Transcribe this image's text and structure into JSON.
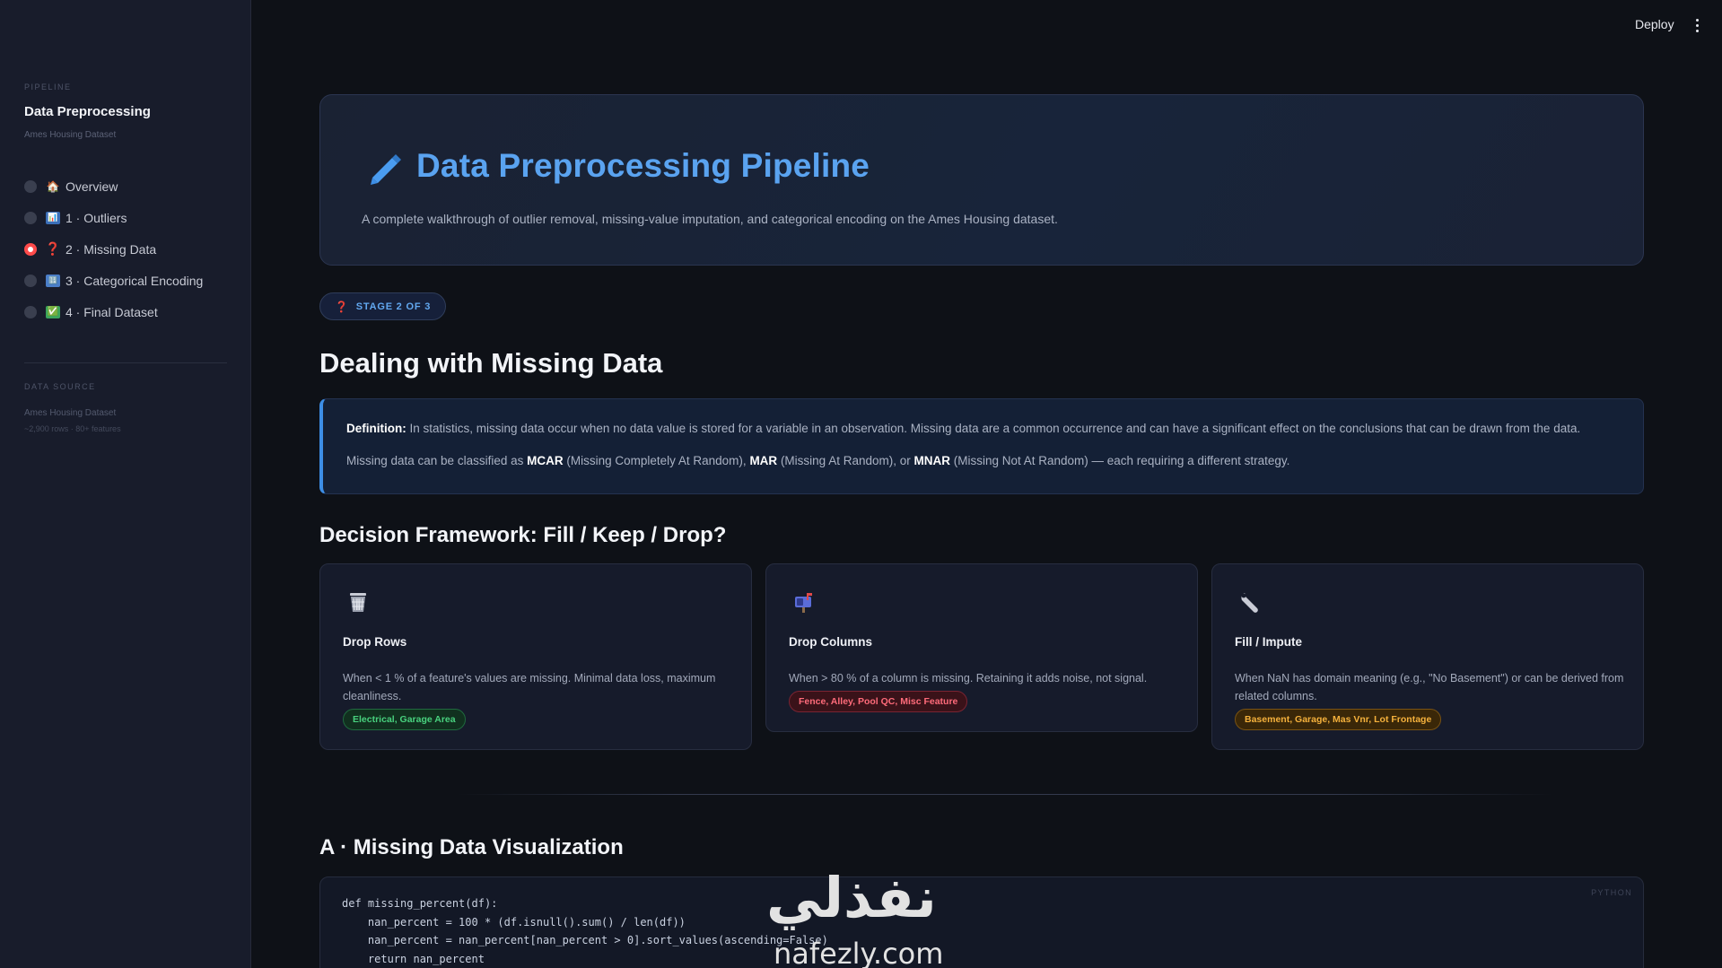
{
  "sidebar": {
    "kicker": "PIPELINE",
    "title": "Data Preprocessing",
    "subtitle": "Ames Housing Dataset",
    "items": [
      {
        "emoji": "🏠",
        "label": "Overview",
        "active": false
      },
      {
        "emoji": "📊",
        "label": "1 · Outliers",
        "active": false
      },
      {
        "emoji": "❓",
        "label": "2 · Missing Data",
        "active": true
      },
      {
        "emoji": "🔢",
        "label": "3 · Categorical Encoding",
        "active": false
      },
      {
        "emoji": "✅",
        "label": "4 · Final Dataset",
        "active": false
      }
    ],
    "data_source_kicker": "DATA SOURCE",
    "data_source_name": "Ames Housing Dataset",
    "data_source_meta": "~2,900 rows · 80+ features"
  },
  "header": {
    "deploy_label": "Deploy"
  },
  "hero": {
    "icon": "pencil-icon",
    "title": "Data Preprocessing Pipeline",
    "description": "A complete walkthrough of outlier removal, missing-value imputation, and categorical encoding on the Ames Housing dataset."
  },
  "stage_badge": {
    "icon": "❓",
    "label": "STAGE 2 OF 3"
  },
  "section_missing": {
    "title": "Dealing with Missing Data",
    "definition": {
      "label": "Definition:",
      "text": " In statistics, missing data occur when no data value is stored for a variable in an observation. Missing data are a common occurrence and can have a significant effect on the conclusions that can be drawn from the data.",
      "classify_prefix": "Missing data can be classified as ",
      "mcar": "MCAR",
      "mcar_desc": " (Missing Completely At Random), ",
      "mar": "MAR",
      "mar_desc": " (Missing At Random), or ",
      "mnar": "MNAR",
      "mnar_desc": " (Missing Not At Random) — each requiring a different strategy."
    }
  },
  "decision": {
    "title": "Decision Framework: Fill / Keep / Drop?",
    "cards": [
      {
        "icon": "wastebasket-icon",
        "title": "Drop Rows",
        "description": "When < 1 % of a feature's values are missing. Minimal data loss, maximum cleanliness.",
        "tag": "Electrical, Garage Area"
      },
      {
        "icon": "mailbox-icon",
        "title": "Drop Columns",
        "description": "When > 80 % of a column is missing. Retaining it adds noise, not signal.",
        "tag": "Fence, Alley, Pool QC, Misc Feature"
      },
      {
        "icon": "wrench-icon",
        "title": "Fill / Impute",
        "description": "When NaN has domain meaning (e.g., \"No Basement\") or can be derived from related columns.",
        "tag": "Basement, Garage, Mas Vnr, Lot Frontage"
      }
    ]
  },
  "visualization": {
    "title": "A · Missing Data Visualization",
    "code_lang": "PYTHON",
    "code_lines": [
      "def missing_percent(df):",
      "    nan_percent = 100 * (df.isnull().sum() / len(df))",
      "    nan_percent = nan_percent[nan_percent > 0].sort_values(ascending=False)",
      "    return nan_percent"
    ]
  },
  "watermark": {
    "arabic": "نفذلي",
    "latin": "nafezly.com"
  },
  "colors": {
    "accent_blue": "#5aa3f0",
    "active_red": "#ff4b4b",
    "tag_green": "#48d17e",
    "tag_red": "#ff6b7a",
    "tag_orange": "#f5b13c"
  }
}
